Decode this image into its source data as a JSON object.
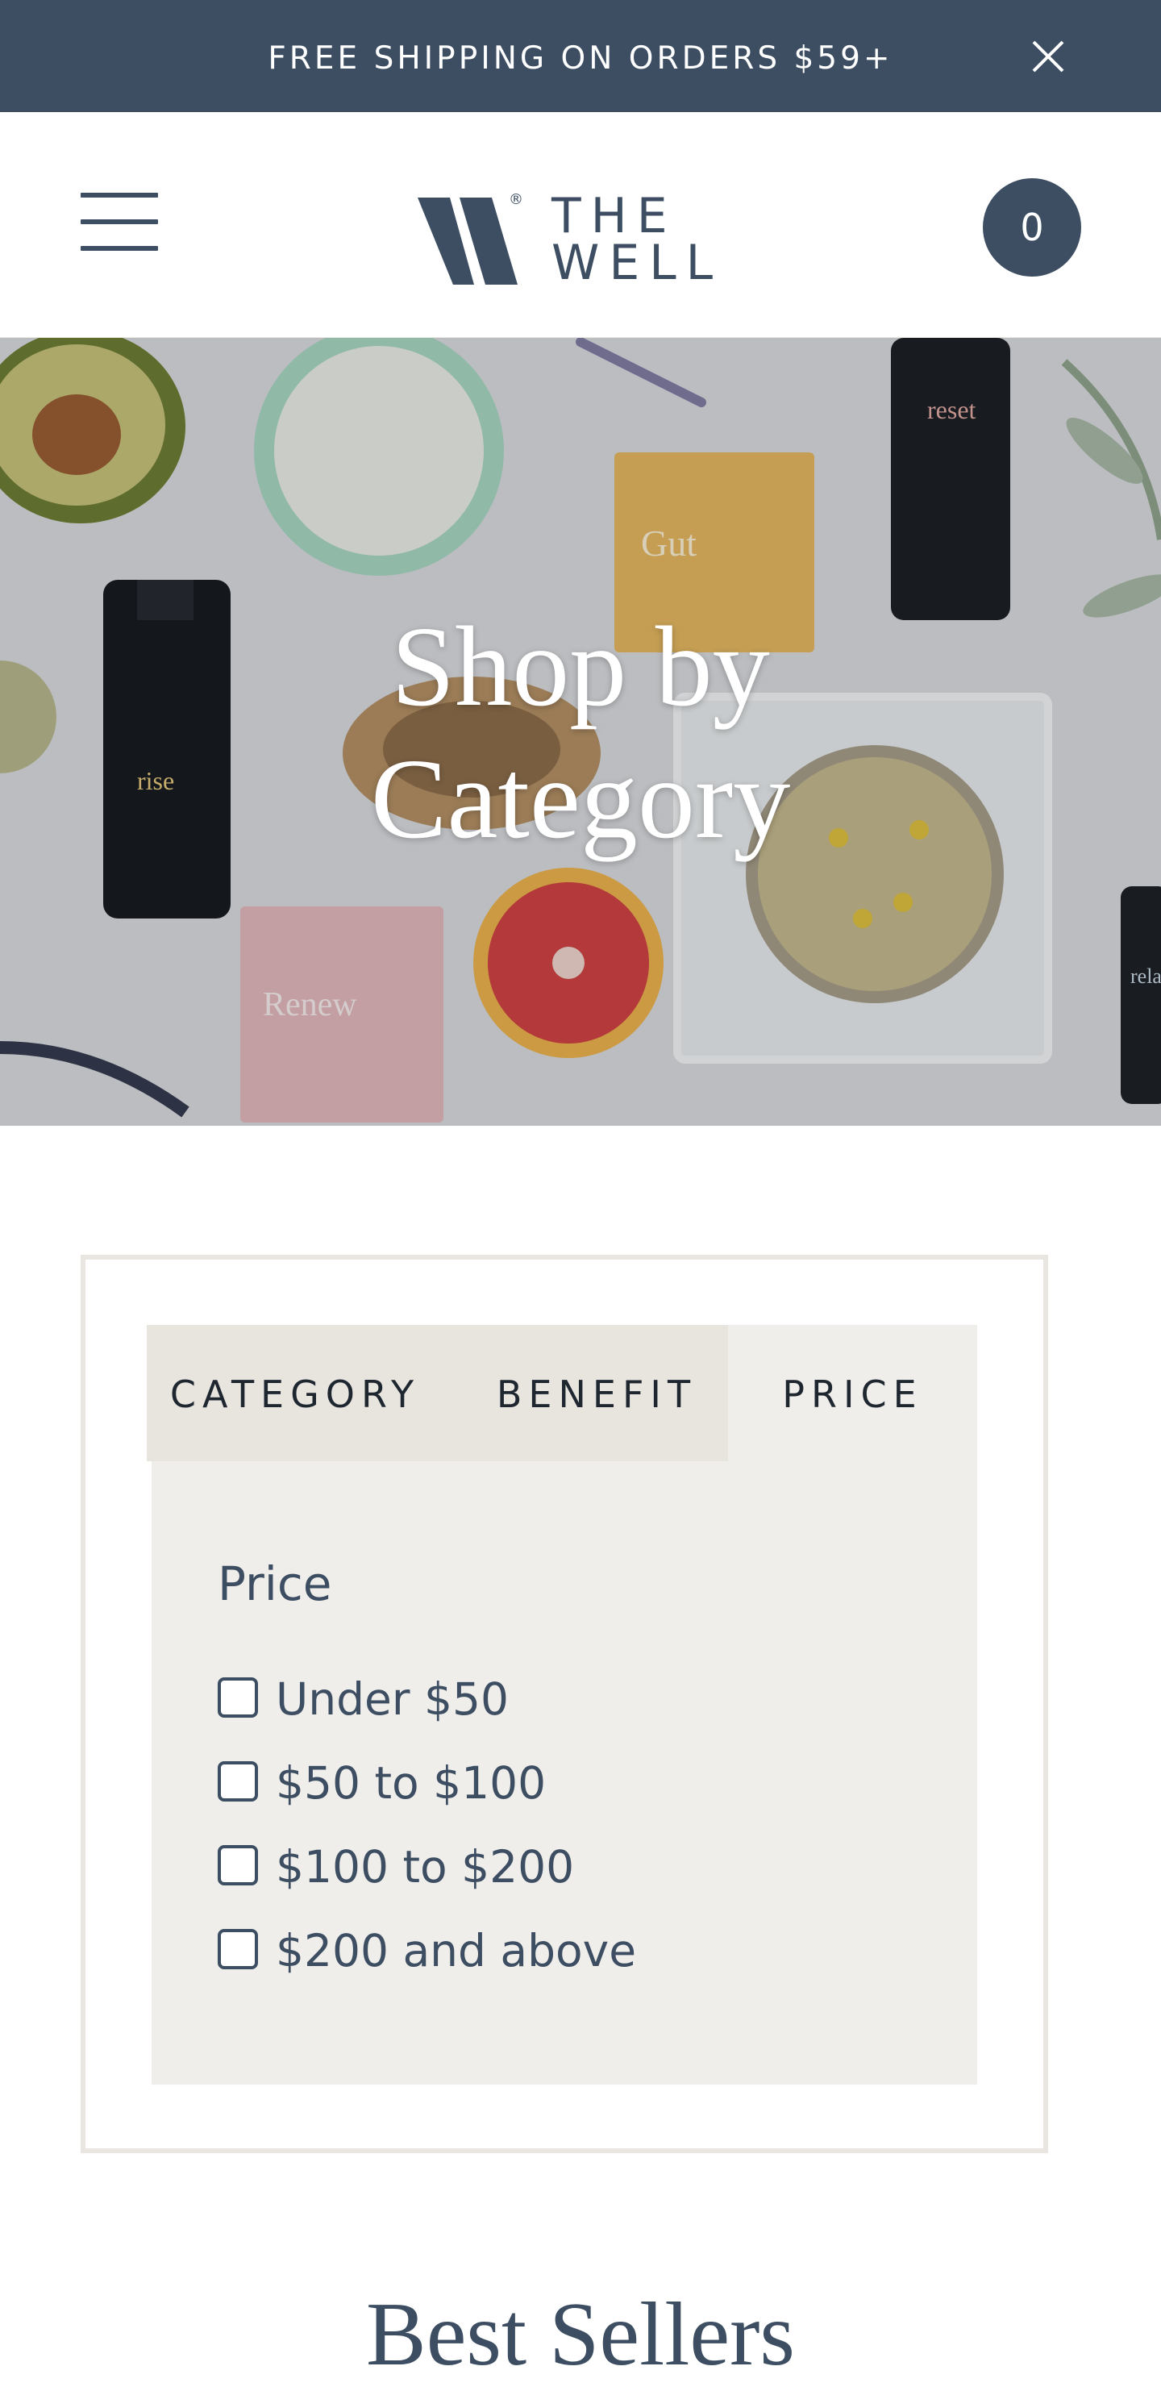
{
  "announcement": {
    "text": "FREE SHIPPING ON ORDERS $59+",
    "close_icon": "close-icon"
  },
  "header": {
    "menu_icon": "hamburger-menu-icon",
    "logo_line1": "THE",
    "logo_line2": "WELL",
    "logo_reg": "®",
    "cart_count": "0"
  },
  "hero": {
    "title": "Shop by\nCategory",
    "product_labels": {
      "reset": "reset",
      "rise": "rise",
      "gut": "Gut",
      "renew": "Renew",
      "rela": "rela"
    }
  },
  "filter": {
    "tabs": [
      {
        "label": "CATEGORY"
      },
      {
        "label": "BENEFIT"
      },
      {
        "label": "PRICE"
      }
    ],
    "panel_title": "Price",
    "options": [
      {
        "label": "Under $50",
        "checked": false
      },
      {
        "label": "$50 to $100",
        "checked": false
      },
      {
        "label": "$100 to $200",
        "checked": false
      },
      {
        "label": "$200 and above",
        "checked": false
      }
    ]
  },
  "section": {
    "title": "Best Sellers"
  },
  "colors": {
    "brand_navy": "#3d4e63",
    "panel_bg": "#f0eeea",
    "tab_bg": "#e8e5df"
  }
}
